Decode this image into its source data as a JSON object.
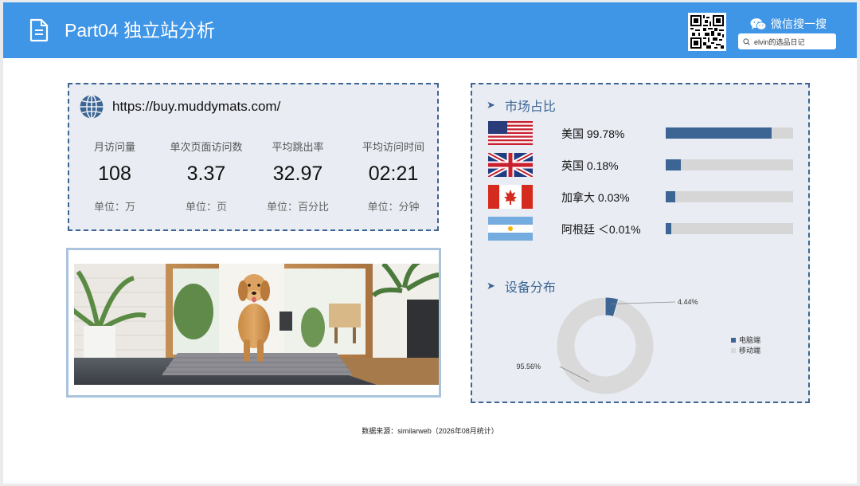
{
  "header": {
    "title": "Part04 独立站分析",
    "wechat_label": "微信搜一搜",
    "search_value": "elvin的选品日记",
    "doc_icon": "document-icon",
    "wechat_icon": "wechat-icon",
    "qr_icon": "qr-code-icon",
    "search_icon": "search-icon",
    "bg_color": "#3f95e6"
  },
  "site": {
    "url": "https://buy.muddymats.com/",
    "icon": "globe-icon",
    "metrics": [
      {
        "label": "月访问量",
        "value": "108",
        "unit": "单位：万"
      },
      {
        "label": "单次页面访问数",
        "value": "3.37",
        "unit": "单位：页"
      },
      {
        "label": "平均跳出率",
        "value": "32.97",
        "unit": "单位：百分比"
      },
      {
        "label": "平均访问时间",
        "value": "02:21",
        "unit": "单位：分钟"
      }
    ]
  },
  "photo": {
    "subject": "golden retriever walking on a grey door mat"
  },
  "market": {
    "title": "市场占比",
    "accent": "#3d6594",
    "rows": [
      {
        "country": "美国 99.78%",
        "flag": "us-flag-icon",
        "share": 0.9978
      },
      {
        "country": "英国 0.18%",
        "flag": "uk-flag-icon",
        "share": 0.0018
      },
      {
        "country": "加拿大 0.03%",
        "flag": "canada-flag-icon",
        "share": 0.0003
      },
      {
        "country": "阿根廷 ＜0.01%",
        "flag": "argentina-flag-icon",
        "share": 0.0001
      }
    ]
  },
  "device": {
    "title": "设备分布",
    "desktop_label": "4.44%",
    "mobile_label": "95.56%",
    "legend": [
      "电脑端",
      "移动端"
    ],
    "colors": [
      "#3d6594",
      "#d9d9d9"
    ]
  },
  "chart_data": {
    "type": "pie",
    "title": "设备分布",
    "categories": [
      "电脑端",
      "移动端"
    ],
    "values": [
      4.44,
      95.56
    ],
    "legend_position": "right"
  },
  "footer": {
    "source": "数据来源：similarweb（2026年08月统计）"
  }
}
